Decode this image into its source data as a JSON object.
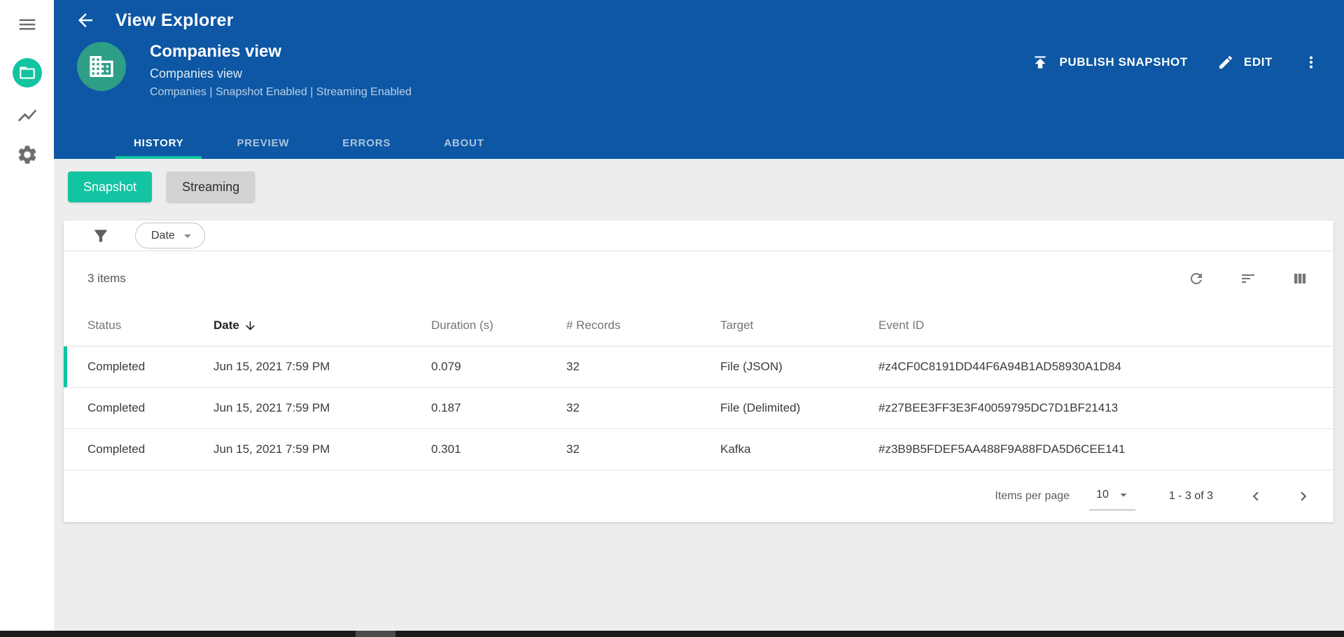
{
  "app": {
    "title": "View Explorer"
  },
  "sidebar": {
    "items": [
      {
        "name": "menu",
        "icon": "hamburger-icon"
      },
      {
        "name": "views",
        "icon": "folder-icon",
        "active": true
      },
      {
        "name": "activity",
        "icon": "line-chart-icon"
      },
      {
        "name": "settings",
        "icon": "gear-icon"
      }
    ]
  },
  "header": {
    "entity": {
      "title": "Companies view",
      "subtitle": "Companies view",
      "caption": "Companies | Snapshot Enabled | Streaming Enabled"
    },
    "actions": {
      "publish_label": "PUBLISH SNAPSHOT",
      "edit_label": "EDIT"
    },
    "tabs": [
      {
        "label": "HISTORY",
        "active": true
      },
      {
        "label": "PREVIEW",
        "active": false
      },
      {
        "label": "ERRORS",
        "active": false
      },
      {
        "label": "ABOUT",
        "active": false
      }
    ]
  },
  "toggle": {
    "snapshot_label": "Snapshot",
    "streaming_label": "Streaming"
  },
  "filter": {
    "date_label": "Date"
  },
  "table": {
    "items_count": "3 items",
    "columns": [
      "Status",
      "Date",
      "Duration (s)",
      "# Records",
      "Target",
      "Event ID"
    ],
    "sort_column": "Date",
    "sort_direction": "descending",
    "rows": [
      {
        "status": "Completed",
        "date": "Jun 15, 2021 7:59 PM",
        "duration": "0.079",
        "records": "32",
        "target": "File (JSON)",
        "event_id": "#z4CF0C8191DD44F6A94B1AD58930A1D84"
      },
      {
        "status": "Completed",
        "date": "Jun 15, 2021 7:59 PM",
        "duration": "0.187",
        "records": "32",
        "target": "File (Delimited)",
        "event_id": "#z27BEE3FF3E3F40059795DC7D1BF21413"
      },
      {
        "status": "Completed",
        "date": "Jun 15, 2021 7:59 PM",
        "duration": "0.301",
        "records": "32",
        "target": "Kafka",
        "event_id": "#z3B9B5FDEF5AA488F9A88FDA5D6CEE141"
      }
    ],
    "pagination": {
      "items_per_page_label": "Items per page",
      "page_size": "10",
      "range_label": "1 - 3 of 3"
    }
  },
  "colors": {
    "header_blue": "#0D57A4",
    "accent_teal": "#12C4A1",
    "page_background": "#EDEDED"
  },
  "icons": {
    "hamburger": "three horizontal bars",
    "folder": "folder outline",
    "line_chart": "zigzag trend line",
    "gear": "settings cog",
    "back_arrow": "left arrow",
    "building": "office building grid",
    "publish": "upload arrow with top bar",
    "pencil": "edit pencil",
    "kebab": "three vertical dots",
    "funnel": "filter funnel",
    "caret_down": "small down triangle",
    "refresh": "circular arrow",
    "sort": "three shrinking lines",
    "columns": "three vertical bars",
    "arrow_down": "downward arrow",
    "chevron_left": "previous page",
    "chevron_right": "next page"
  }
}
